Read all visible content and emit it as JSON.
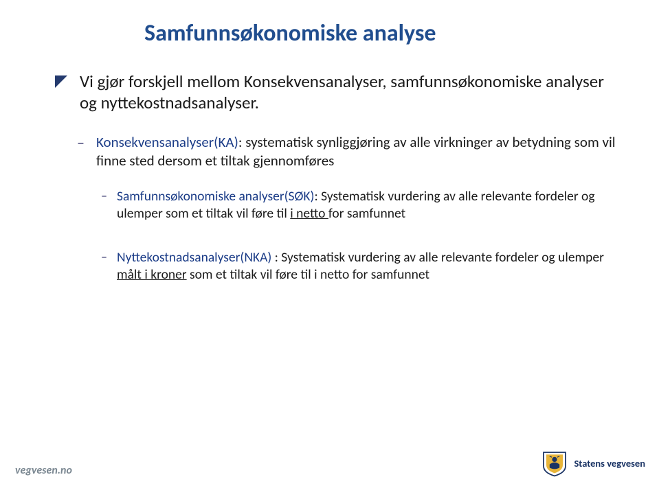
{
  "title": "Samfunnsøkonomiske analyse",
  "main": {
    "text": "Vi gjør forskjell mellom Konsekvensanalyser, samfunnsøkonomiske analyser og nyttekostnadsanalyser."
  },
  "sub1": {
    "term": "Konsekvensanalyser(KA)",
    "rest": ": systematisk synliggjøring av alle virkninger av betydning som vil finne sted dersom et tiltak gjennomføres"
  },
  "nested1": {
    "term": "Samfunnsøkonomiske analyser(SØK)",
    "mid": ": Systematisk vurdering av alle relevante fordeler og ulemper som et tiltak vil føre til ",
    "underlined": "i netto ",
    "after": "for samfunnet"
  },
  "nested2": {
    "term": "Nyttekostnadsanalyser(NKA)",
    "mid": " : Systematisk vurdering av alle relevante fordeler og ulemper ",
    "underlined": "målt i kroner",
    "after": " som et tiltak vil føre til i netto for samfunnet"
  },
  "footer": {
    "left": "vegvesen.no",
    "right": "Statens vegvesen"
  }
}
